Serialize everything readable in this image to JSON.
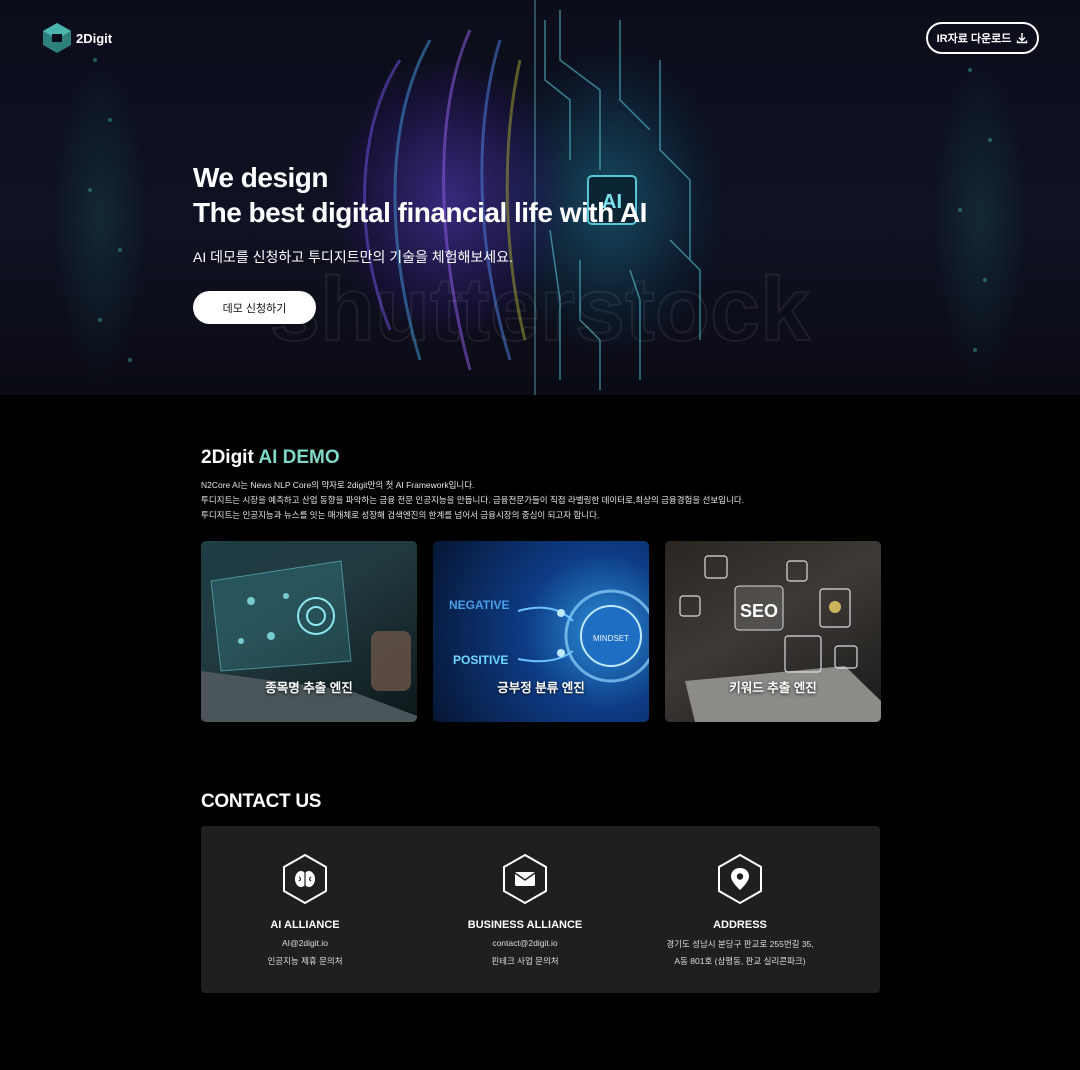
{
  "brand": {
    "name": "2Digit"
  },
  "header": {
    "ir_button_label": "IR자료 다운로드"
  },
  "hero": {
    "title_line1": "We design",
    "title_line2": "The best digital financial life with AI",
    "subtitle": "AI 데모를 신청하고 투디지트만의 기술을 체험해보세요.",
    "cta_label": "데모 신청하기",
    "watermark": "shutterstock"
  },
  "demo": {
    "title_prefix": "2Digit",
    "title_accent": "AI DEMO",
    "description": [
      "N2Core AI는 News NLP Core의 약자로 2digit만의 첫 AI Framework입니다.",
      "투디지트는 시장을 예측하고 산업 동향을 파악하는 금융 전문 인공지능을 만듭니다. 금융전문가들이 직접 라벨링한 데이터로,최상의 금융경험을 선보입니다.",
      "투디지트는 인공지능과 뉴스를 잇는 매개체로 성장해 검색엔진의 한계를 넘어서 금융시장의 중심이 되고자 합니다."
    ],
    "cards": [
      {
        "label": "종목명 추출 엔진"
      },
      {
        "label": "긍부정 분류 엔진",
        "overlay_negative": "NEGATIVE",
        "overlay_positive": "POSITIVE",
        "overlay_mindset": "MINDSET"
      },
      {
        "label": "키워드 추출 엔진",
        "overlay_seo": "SEO"
      }
    ]
  },
  "contact": {
    "title": "CONTACT US",
    "items": [
      {
        "icon": "brain-icon",
        "heading": "AI ALLIANCE",
        "line1": "AI@2digit.io",
        "line2": "인공지능 제휴 문의처"
      },
      {
        "icon": "envelope-icon",
        "heading": "BUSINESS ALLIANCE",
        "line1": "contact@2digit.io",
        "line2": "핀테크 사업 문의처"
      },
      {
        "icon": "location-pin-icon",
        "heading": "ADDRESS",
        "line1": "경기도 성남시 분당구 판교로 255번길 35,",
        "line2": "A동 801호 (삼평동, 판교 실리콘파크)"
      }
    ]
  },
  "colors": {
    "accent": "#7fd8c8",
    "background": "#000000",
    "contact_box": "#1f1f1f"
  }
}
